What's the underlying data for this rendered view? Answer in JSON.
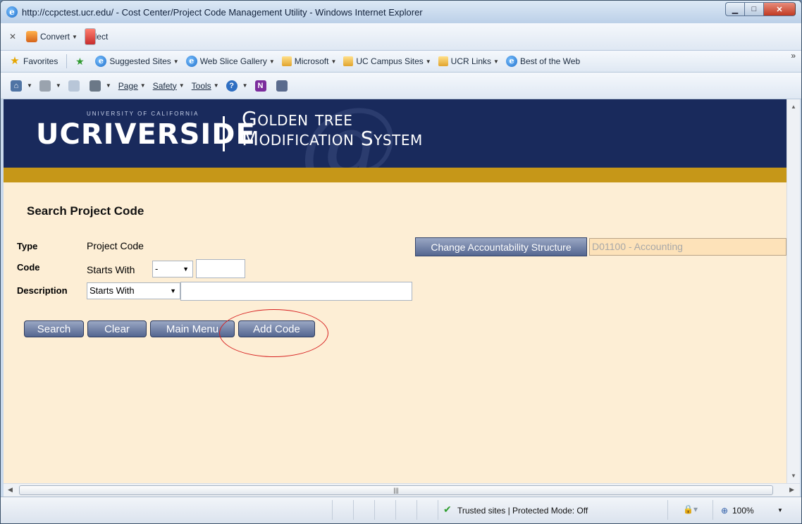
{
  "window": {
    "title": "http://ccpctest.ucr.edu/ - Cost Center/Project Code Management Utility - Windows Internet Explorer"
  },
  "command_bar": {
    "convert_label": "Convert",
    "select_label": "Select"
  },
  "favorites_bar": {
    "favorites_label": "Favorites",
    "items": [
      "Suggested Sites",
      "Web Slice Gallery",
      "Microsoft",
      "UC Campus Sites",
      "UCR Links",
      "Best of the Web"
    ]
  },
  "tools_bar": {
    "page_label": "Page",
    "safety_label": "Safety",
    "tools_label": "Tools"
  },
  "banner": {
    "university_line": "UNIVERSITY OF CALIFORNIA",
    "logo_text": "UCRIVERSIDE",
    "system_title_line1": "Golden tree",
    "system_title_line2": "Modification System"
  },
  "form": {
    "heading": "Search Project Code",
    "type_label": "Type",
    "type_value": "Project Code",
    "code_label": "Code",
    "code_operator_text": "Starts With",
    "code_select_value": "-",
    "description_label": "Description",
    "description_select_value": "Starts With",
    "change_structure_button": "Change Accountability Structure",
    "accountability_value": "D01100 - Accounting",
    "buttons": {
      "search": "Search",
      "clear": "Clear",
      "main_menu": "Main Menu",
      "add_code": "Add Code"
    }
  },
  "status_bar": {
    "zone_text": "Trusted sites | Protected Mode: Off",
    "zoom": "100%"
  }
}
